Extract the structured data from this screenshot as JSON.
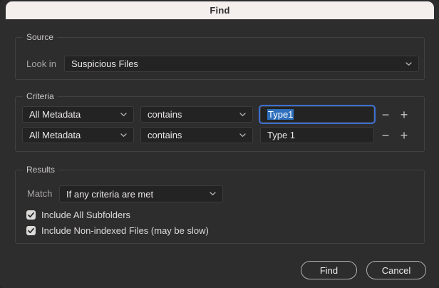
{
  "window": {
    "title": "Find"
  },
  "source": {
    "legend": "Source",
    "look_in_label": "Look in",
    "look_in_value": "Suspicious Files"
  },
  "criteria": {
    "legend": "Criteria",
    "rows": [
      {
        "field": "All Metadata",
        "operator": "contains",
        "value": "Type1",
        "focused": true
      },
      {
        "field": "All Metadata",
        "operator": "contains",
        "value": "Type 1",
        "focused": false
      }
    ],
    "remove_label": "−",
    "add_label": "+"
  },
  "results": {
    "legend": "Results",
    "match_label": "Match",
    "match_value": "If any criteria are met",
    "checkboxes": [
      {
        "label": "Include All Subfolders",
        "checked": true
      },
      {
        "label": "Include Non-indexed Files (may be slow)",
        "checked": true
      }
    ]
  },
  "footer": {
    "find_label": "Find",
    "cancel_label": "Cancel"
  },
  "icons": {
    "chevron_down": "chevron-down",
    "check": "check"
  },
  "colors": {
    "titlebar_bg": "#f4eeed",
    "dialog_bg": "#2e2d2d",
    "control_bg": "#242323",
    "focus_ring": "#3b6fd0",
    "selection_bg": "#2e70bd",
    "checkbox_bg": "#dcdbda"
  }
}
